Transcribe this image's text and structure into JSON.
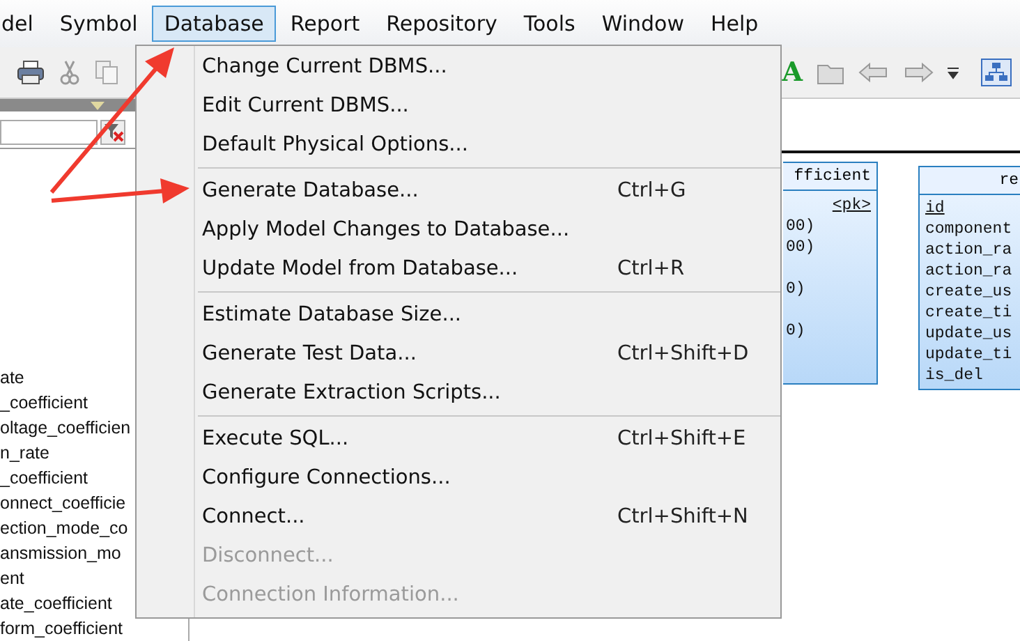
{
  "menubar": [
    {
      "label": "del",
      "selected": false
    },
    {
      "label": "Symbol",
      "selected": false
    },
    {
      "label": "Database",
      "selected": true
    },
    {
      "label": "Report",
      "selected": false
    },
    {
      "label": "Repository",
      "selected": false
    },
    {
      "label": "Tools",
      "selected": false
    },
    {
      "label": "Window",
      "selected": false
    },
    {
      "label": "Help",
      "selected": false
    }
  ],
  "toolbar": {
    "glyph": "A"
  },
  "tree": {
    "items": [
      "ate",
      "_coefficient",
      "oltage_coefficien",
      "n_rate",
      "_coefficient",
      "onnect_coefficie",
      "ection_mode_co",
      "ansmission_mo",
      "ent",
      "ate_coefficient",
      "form_coefficient"
    ]
  },
  "tables": [
    {
      "title": "fficient",
      "rows": [
        {
          "text": "<pk>",
          "underlined": true,
          "spaced": false
        },
        {
          "text": "00)",
          "underlined": false,
          "spaced": false
        },
        {
          "text": "00)",
          "underlined": false,
          "spaced": false
        },
        {
          "text": "0)",
          "underlined": false,
          "spaced": true
        },
        {
          "text": "0)",
          "underlined": false,
          "spaced": true
        }
      ]
    },
    {
      "title": "re",
      "rows": [
        {
          "text": "id",
          "underlined": true
        },
        {
          "text": "component",
          "underlined": false
        },
        {
          "text": "action_ra",
          "underlined": false
        },
        {
          "text": "action_ra",
          "underlined": false
        },
        {
          "text": "create_us",
          "underlined": false
        },
        {
          "text": "create_ti",
          "underlined": false
        },
        {
          "text": "update_us",
          "underlined": false
        },
        {
          "text": "update_ti",
          "underlined": false
        },
        {
          "text": "is_del",
          "underlined": false
        }
      ]
    }
  ],
  "menu": {
    "groups": [
      [
        {
          "label": "Change Current DBMS...",
          "disabled": false
        },
        {
          "label": "Edit Current DBMS...",
          "disabled": false
        },
        {
          "label": "Default Physical Options...",
          "disabled": false
        }
      ],
      [
        {
          "label": "Generate Database...",
          "shortcut": "Ctrl+G",
          "disabled": false
        },
        {
          "label": "Apply Model Changes to Database...",
          "disabled": false
        },
        {
          "label": "Update Model from Database...",
          "shortcut": "Ctrl+R",
          "disabled": false
        }
      ],
      [
        {
          "label": "Estimate Database Size...",
          "disabled": false
        },
        {
          "label": "Generate Test Data...",
          "shortcut": "Ctrl+Shift+D",
          "disabled": false
        },
        {
          "label": "Generate Extraction Scripts...",
          "disabled": false
        }
      ],
      [
        {
          "label": "Execute SQL...",
          "shortcut": "Ctrl+Shift+E",
          "disabled": false
        },
        {
          "label": "Configure Connections...",
          "disabled": false
        },
        {
          "label": "Connect...",
          "shortcut": "Ctrl+Shift+N",
          "disabled": false
        },
        {
          "label": "Disconnect...",
          "disabled": true
        },
        {
          "label": "Connection Information...",
          "disabled": true
        }
      ]
    ]
  }
}
